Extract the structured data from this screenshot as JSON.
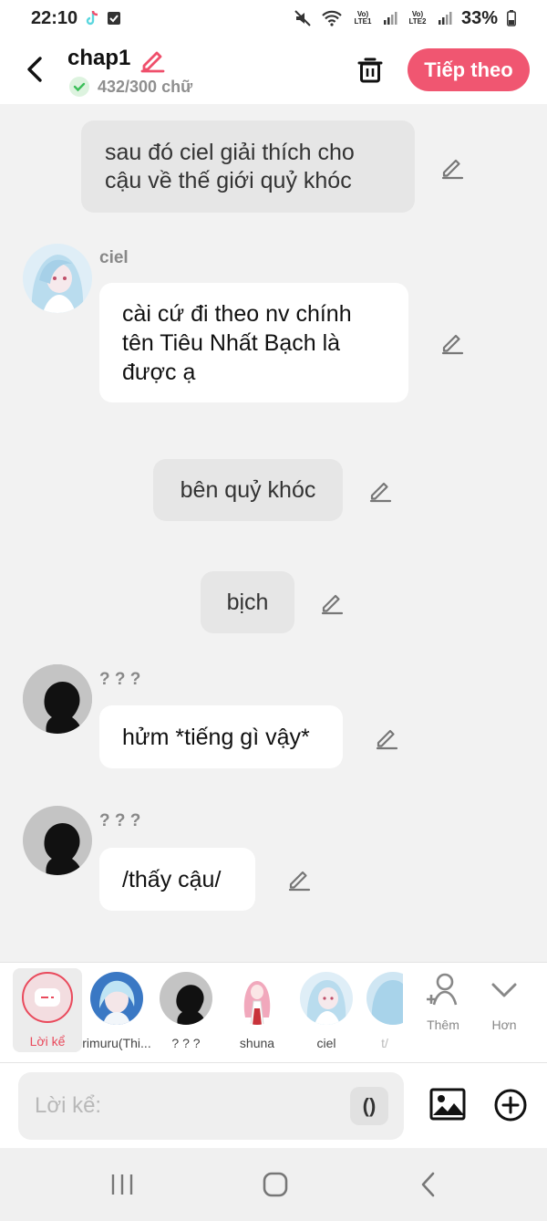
{
  "status_bar": {
    "time": "22:10",
    "battery": "33%",
    "sim1": "Vo) LTE1",
    "sim2": "Vo) LTE2"
  },
  "header": {
    "title": "chap1",
    "word_count": "432/300 chữ",
    "next_label": "Tiếp theo"
  },
  "messages": [
    {
      "type": "narration",
      "text": "sau đó ciel giải thích cho cậu về thế giới quỷ khóc"
    },
    {
      "type": "character",
      "speaker": "ciel",
      "text": "cài cứ đi theo nv chính tên Tiêu Nhất Bạch là được ạ"
    },
    {
      "type": "narration",
      "text": "bên quỷ khóc"
    },
    {
      "type": "narration",
      "text": "bịch"
    },
    {
      "type": "character",
      "speaker": "? ? ?",
      "text": "hửm *tiếng gì vậy*"
    },
    {
      "type": "character",
      "speaker": "? ? ?",
      "text": "/thấy cậu/"
    }
  ],
  "characters": [
    {
      "label": "Lời kể",
      "selected": true
    },
    {
      "label": "rimuru(Thi..."
    },
    {
      "label": "? ? ?"
    },
    {
      "label": "shuna"
    },
    {
      "label": "ciel"
    },
    {
      "label": "t/"
    }
  ],
  "tools": {
    "add_label": "Thêm",
    "more_label": "Hơn"
  },
  "input": {
    "placeholder": "Lời kể:",
    "paren_label": "()"
  },
  "colors": {
    "accent": "#f05671",
    "narration_bg": "#e6e6e6",
    "bubble_bg": "#ffffff"
  }
}
